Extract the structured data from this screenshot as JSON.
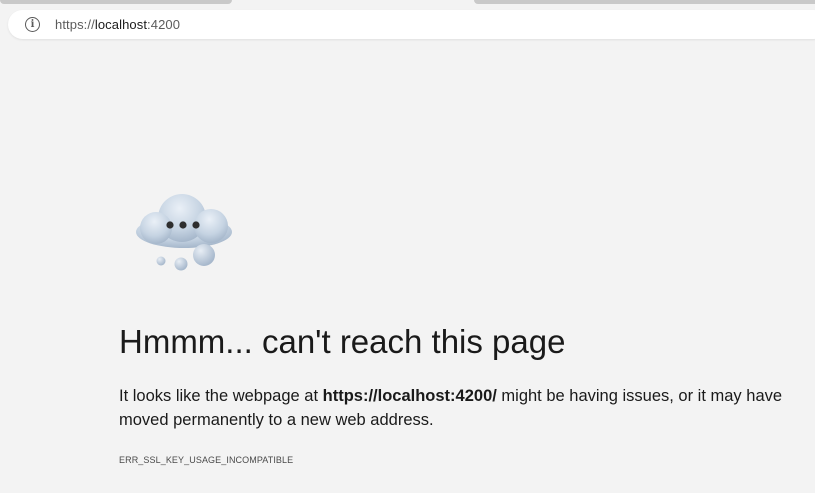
{
  "browser": {
    "url_scheme": "https://",
    "url_host": "localhost",
    "url_port": ":4200"
  },
  "error_page": {
    "title": "Hmmm... can't reach this page",
    "message_prefix": "It looks like the webpage at ",
    "message_url": "https://localhost:4200/",
    "message_suffix": " might be having issues, or it may have moved permanently to a new web address.",
    "error_code": "ERR_SSL_KEY_USAGE_INCOMPATIBLE"
  },
  "icons": {
    "site_info": "info-icon",
    "illustration": "cloud-icon"
  }
}
